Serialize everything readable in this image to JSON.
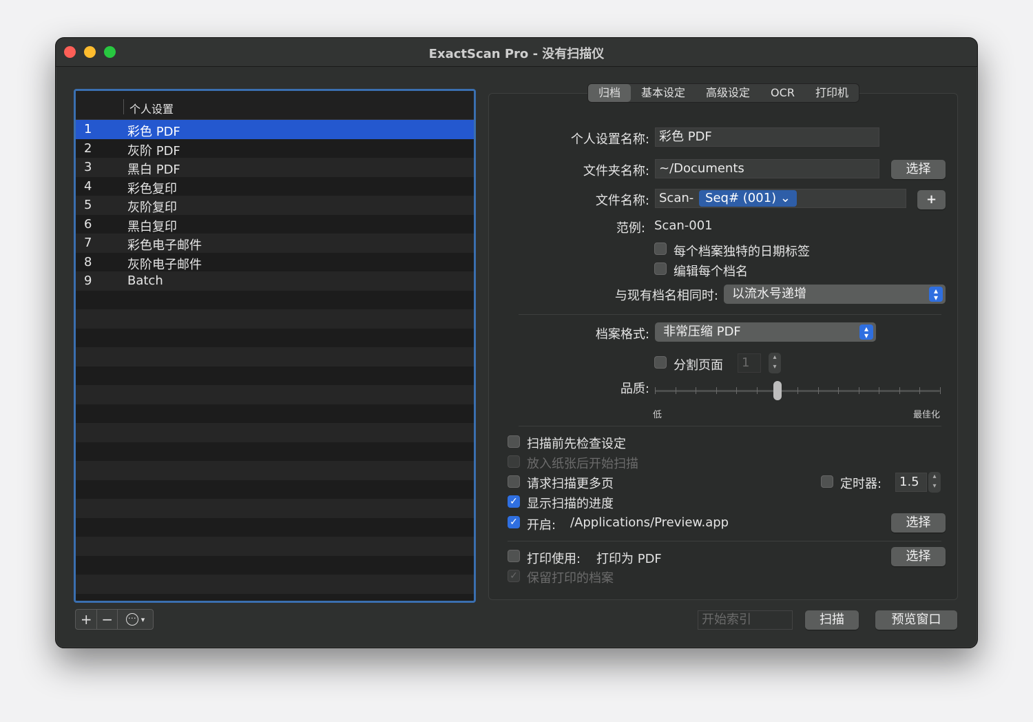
{
  "window": {
    "title": "ExactScan Pro - 没有扫描仪"
  },
  "profiles": {
    "header": "个人设置",
    "rows": [
      {
        "num": "1",
        "name": "彩色 PDF",
        "selected": true
      },
      {
        "num": "2",
        "name": "灰阶 PDF"
      },
      {
        "num": "3",
        "name": "黑白 PDF"
      },
      {
        "num": "4",
        "name": "彩色复印"
      },
      {
        "num": "5",
        "name": "灰阶复印"
      },
      {
        "num": "6",
        "name": "黑白复印"
      },
      {
        "num": "7",
        "name": "彩色电子邮件"
      },
      {
        "num": "8",
        "name": "灰阶电子邮件"
      },
      {
        "num": "9",
        "name": "Batch"
      }
    ],
    "add_icon": "+",
    "remove_icon": "−",
    "more_icon": "⋯"
  },
  "tabs": [
    "归档",
    "基本设定",
    "高级设定",
    "OCR",
    "打印机"
  ],
  "archive": {
    "profile_name_label": "个人设置名称:",
    "profile_name_value": "彩色 PDF",
    "folder_label": "文件夹名称:",
    "folder_value": "~/Documents",
    "folder_choose": "选择",
    "filename_label": "文件名称:",
    "filename_prefix": "Scan-",
    "filename_token": "Seq# (001) ⌄",
    "filename_add": "+",
    "example_label": "范例:",
    "example_value": "Scan-001",
    "unique_date": "每个档案独特的日期标签",
    "edit_each": "编辑每个档名",
    "conflict_label": "与现有档名相同时:",
    "conflict_value": "以流水号递增",
    "format_label": "档案格式:",
    "format_value": "非常压缩 PDF",
    "split_pages": "分割页面",
    "split_value": "1",
    "quality_label": "品质:",
    "quality_low": "低",
    "quality_best": "最佳化",
    "quality_level": 0.43,
    "check_settings": "扫描前先检查设定",
    "start_on_paper": "放入纸张后开始扫描",
    "request_more": "请求扫描更多页",
    "timer_label": "定时器:",
    "timer_value": "1.5",
    "show_progress": "显示扫描的进度",
    "open_label": "开启:",
    "open_value": "/Applications/Preview.app",
    "open_choose": "选择",
    "print_label": "打印使用:",
    "print_value": "打印为 PDF",
    "print_choose": "选择",
    "keep_printed": "保留打印的档案"
  },
  "bottom": {
    "start_index_placeholder": "开始索引",
    "scan_button": "扫描",
    "preview_button": "预览窗口"
  }
}
